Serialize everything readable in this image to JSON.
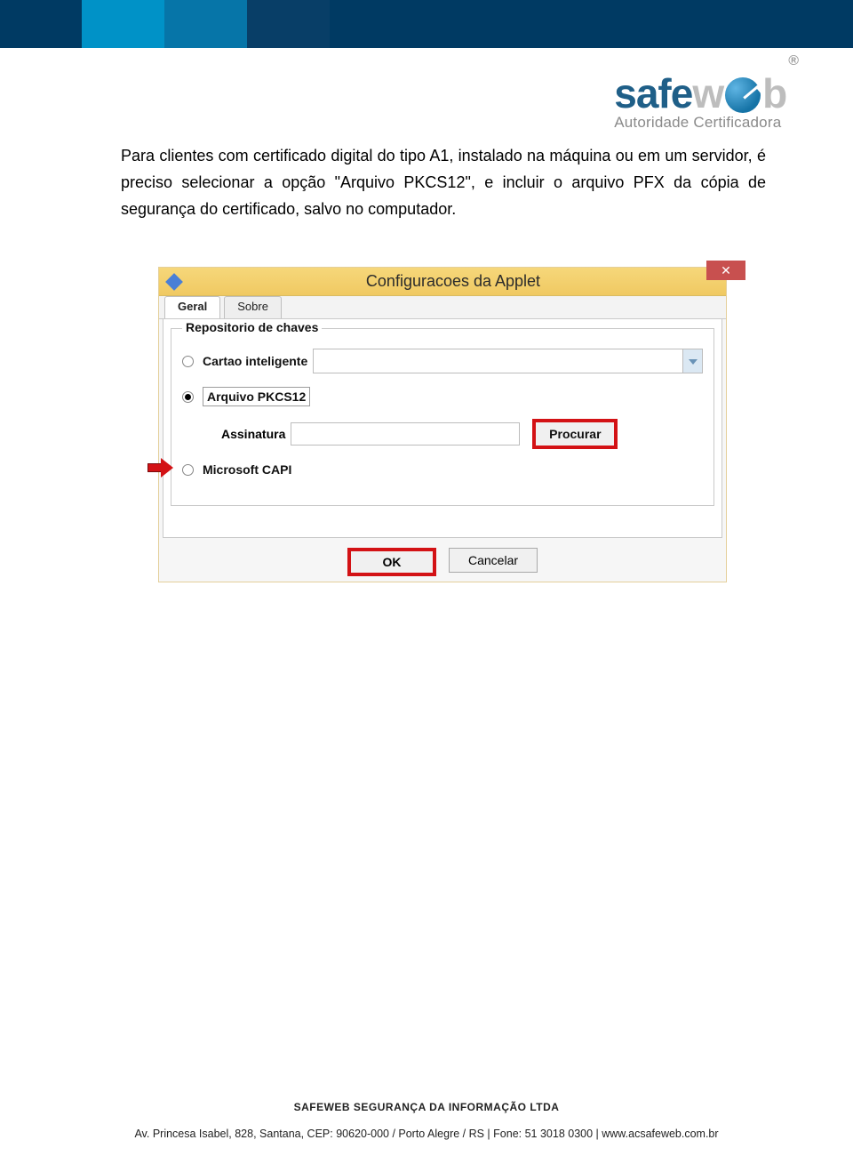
{
  "logo": {
    "sub": "Autoridade Certificadora",
    "reg": "®"
  },
  "intro": "Para clientes com certificado digital do tipo A1, instalado na máquina ou em um servidor, é preciso selecionar a opção \"Arquivo PKCS12\", e incluir o arquivo PFX da cópia de segurança do certificado, salvo no computador.",
  "dialog": {
    "title": "Configuracoes da Applet",
    "tabs": {
      "geral": "Geral",
      "sobre": "Sobre"
    },
    "fieldset_legend": "Repositorio de chaves",
    "opts": {
      "cartao": "Cartao inteligente",
      "pkcs12": "Arquivo PKCS12",
      "capi": "Microsoft CAPI"
    },
    "assinatura_label": "Assinatura",
    "procurar": "Procurar",
    "ok": "OK",
    "cancelar": "Cancelar"
  },
  "footer": {
    "line1": "SAFEWEB SEGURANÇA DA INFORMAÇÃO LTDA",
    "line2": "Av. Princesa Isabel, 828, Santana, CEP: 90620-000 / Porto Alegre / RS |  Fone: 51 3018 0300  |  www.acsafeweb.com.br"
  }
}
